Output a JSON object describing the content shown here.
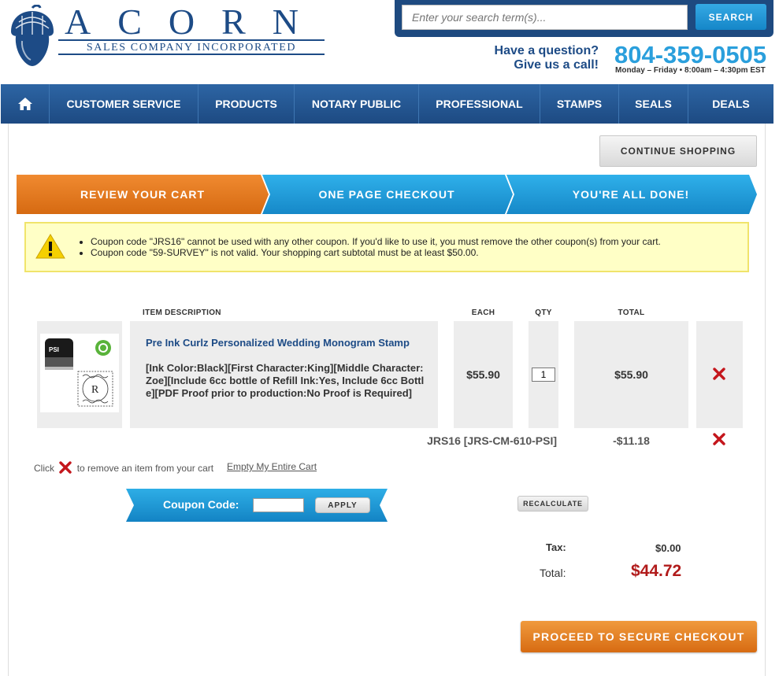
{
  "brand": {
    "logo_word": "ACORN",
    "logo_sub": "SALES COMPANY INCORPORATED",
    "color_primary": "#1d4b86",
    "color_accent": "#2a9fdc"
  },
  "search": {
    "placeholder": "Enter your search term(s)...",
    "button_label": "SEARCH"
  },
  "contact": {
    "question_line1": "Have a question?",
    "question_line2": "Give us a call!",
    "phone": "804-359-0505",
    "hours": "Monday – Friday • 8:00am – 4:30pm EST"
  },
  "nav": {
    "home_icon": "home-icon",
    "items": [
      "CUSTOMER SERVICE",
      "PRODUCTS",
      "NOTARY PUBLIC",
      "PROFESSIONAL",
      "STAMPS",
      "SEALS",
      "DEALS"
    ]
  },
  "actions": {
    "continue_shopping": "CONTINUE SHOPPING",
    "recalculate": "RECALCULATE",
    "proceed_checkout": "PROCEED TO SECURE CHECKOUT"
  },
  "steps": [
    {
      "label": "REVIEW YOUR CART",
      "color": "#e07a22",
      "active": true
    },
    {
      "label": "ONE PAGE CHECKOUT",
      "color": "#1f9bd8",
      "active": false
    },
    {
      "label": "YOU'RE ALL DONE!",
      "color": "#1f9bd8",
      "active": false
    }
  ],
  "alert": {
    "icon": "warning-icon",
    "messages": [
      "Coupon code \"JRS16\" cannot be used with any other coupon. If you'd like to use it, you must remove the other coupon(s) from your cart.",
      "Coupon code \"59-SURVEY\" is not valid. Your shopping cart subtotal must be at least $50.00."
    ]
  },
  "cart": {
    "headers": {
      "item_description": "ITEM  DESCRIPTION",
      "each": "EACH",
      "qty": "QTY",
      "total": "TOTAL"
    },
    "items": [
      {
        "name": "Pre Ink Curlz Personalized Wedding Monogram Stamp",
        "options": "[Ink Color:Black][First Character:King][Middle Character:Zoe][Include 6cc bottle of Refill Ink:Yes, Include 6cc Bottle][PDF Proof prior to production:No Proof is Required]",
        "each": "$55.90",
        "qty": "1",
        "total": "$55.90",
        "image_stamp_label": "PSI",
        "image_monogram_letter": "R"
      }
    ],
    "coupon_line": {
      "name": "JRS16 [JRS-CM-610-PSI]",
      "amount": "-$11.18"
    },
    "remove_hint_before": "Click",
    "remove_hint_after": "to remove an item from your cart",
    "empty_cart": "Empty My Entire Cart"
  },
  "coupon": {
    "label": "Coupon Code:",
    "value": "",
    "apply": "APPLY"
  },
  "totals": {
    "tax_label": "Tax:",
    "tax_value": "$0.00",
    "total_label": "Total:",
    "total_value": "$44.72",
    "total_color": "#b11b1b"
  }
}
